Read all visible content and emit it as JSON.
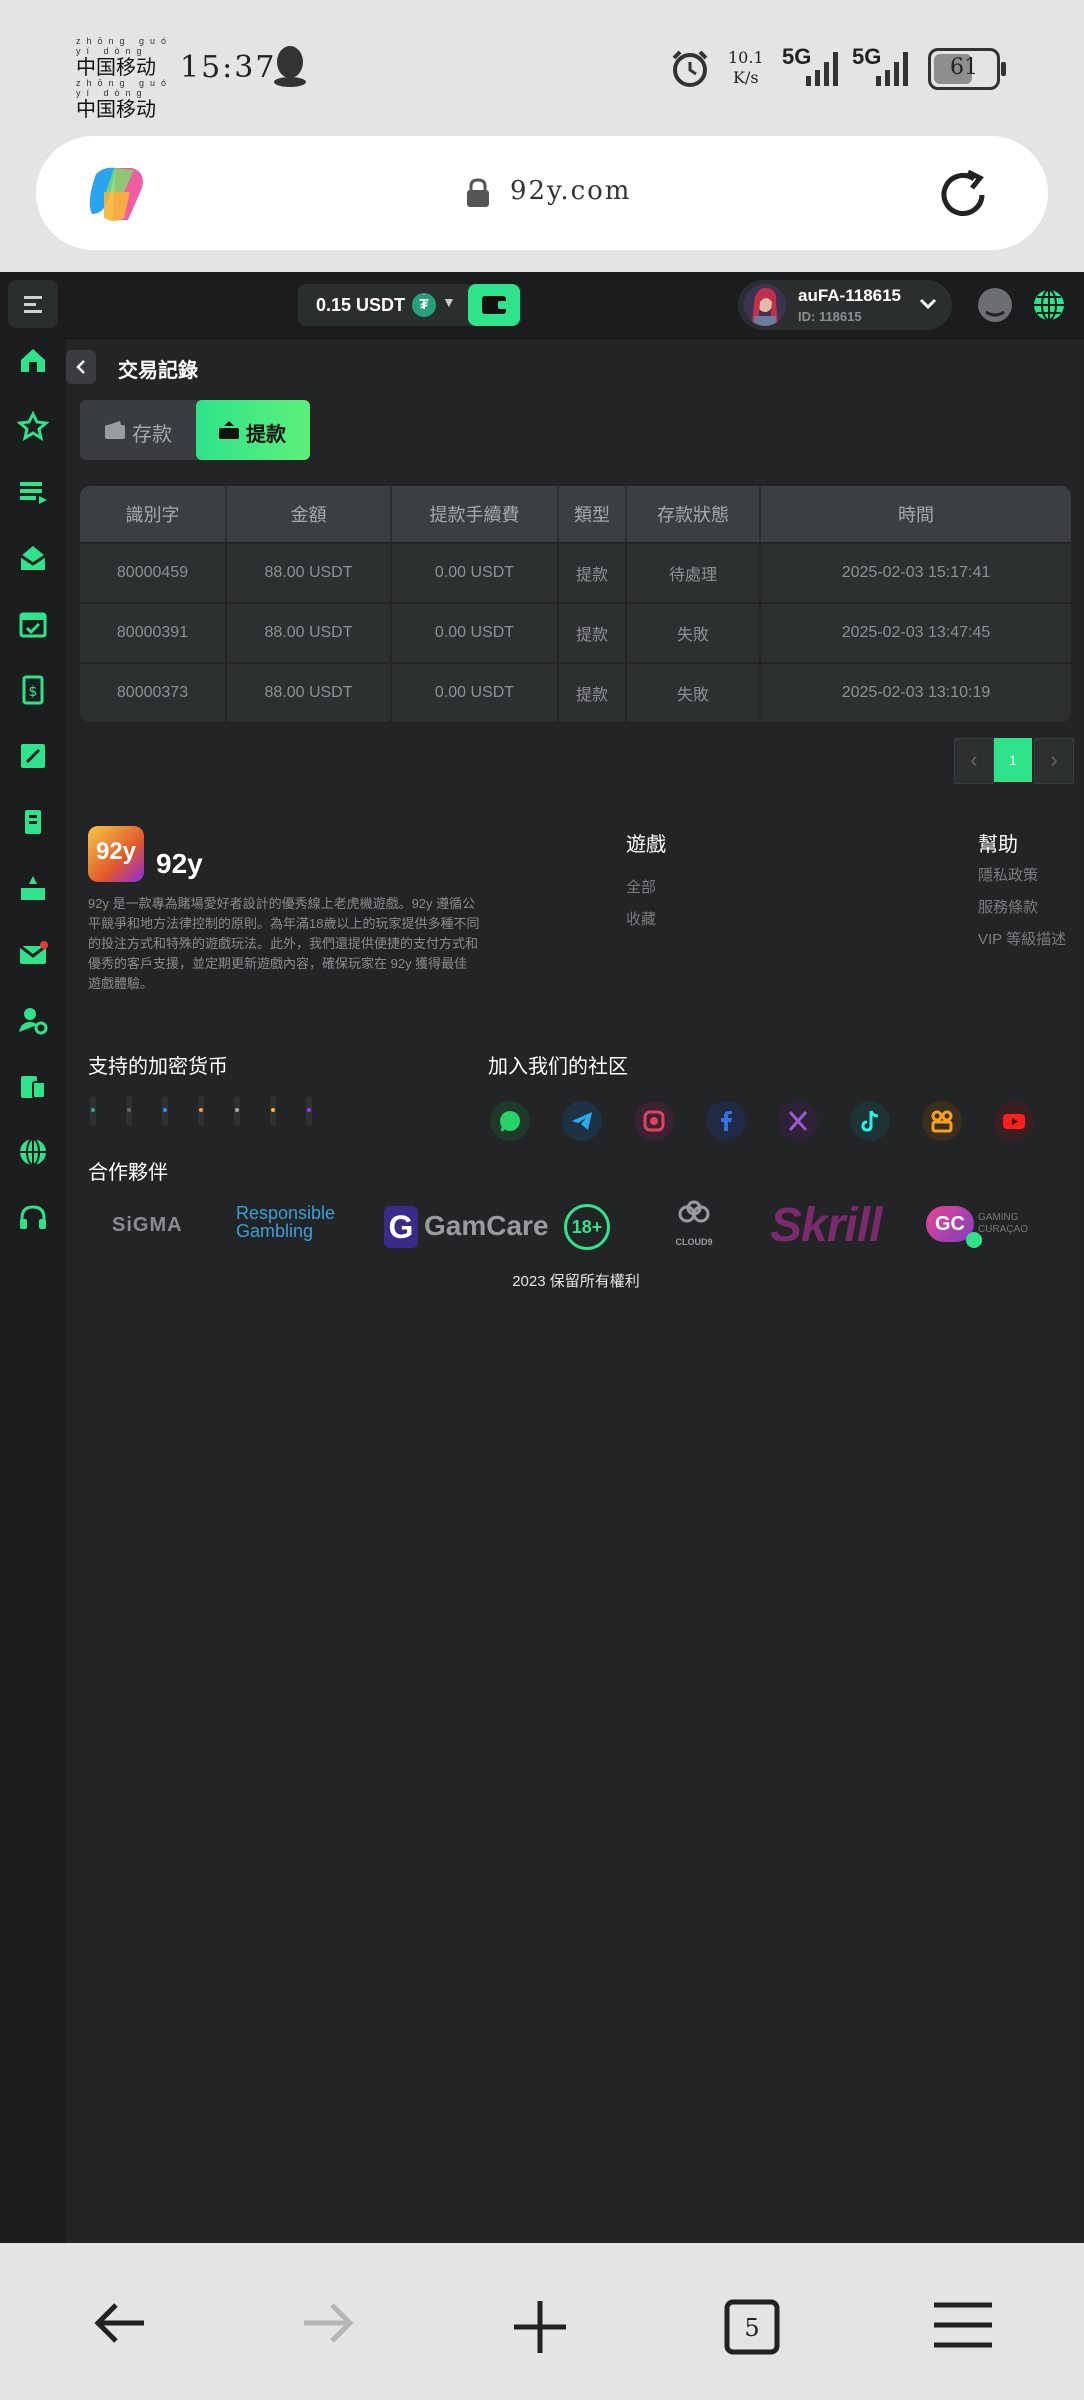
{
  "status": {
    "carrier_pinyin": "zhōng guó  yí dòng",
    "carrier1": "中国移动",
    "carrier2": "中国移动",
    "time": "15:37",
    "speed_value": "10.1",
    "speed_unit": "K/s",
    "net1": "5G",
    "net2": "5G",
    "battery": "61"
  },
  "browser": {
    "url": "92y.com"
  },
  "header": {
    "balance": "0.15 USDT",
    "username": "auFA-118615",
    "user_id": "ID: 118615"
  },
  "page": {
    "title": "交易記錄",
    "tabs": [
      {
        "label": "存款"
      },
      {
        "label": "提款"
      }
    ]
  },
  "table": {
    "headers": [
      "識別字",
      "金額",
      "提款手續費",
      "類型",
      "存款狀態",
      "時間"
    ],
    "rows": [
      [
        "80000459",
        "88.00 USDT",
        "0.00 USDT",
        "提款",
        "待處理",
        "2025-02-03 15:17:41"
      ],
      [
        "80000391",
        "88.00 USDT",
        "0.00 USDT",
        "提款",
        "失敗",
        "2025-02-03 13:47:45"
      ],
      [
        "80000373",
        "88.00 USDT",
        "0.00 USDT",
        "提款",
        "失敗",
        "2025-02-03 13:10:19"
      ]
    ]
  },
  "pagination": {
    "current": "1",
    "prev": "‹",
    "next": "›"
  },
  "footer": {
    "logo_badge": "92y",
    "brand": "92y",
    "description": "92y 是一款專為賭場愛好者設計的優秀線上老虎機遊戲。92y 遵循公平競爭和地方法律控制的原則。為年滿18歲以上的玩家提供多種不同的投注方式和特殊的遊戲玩法。此外，我們還提供便捷的支付方式和優秀的客戶支援，並定期更新遊戲內容，確保玩家在 92y 獲得最佳遊戲體驗。",
    "games": {
      "title": "遊戲",
      "links": [
        "全部",
        "收藏"
      ]
    },
    "help": {
      "title": "幫助",
      "links": [
        "隱私政策",
        "服務條款",
        "VIP 等級描述"
      ]
    },
    "crypto_title": "支持的加密货币",
    "community_title": "加入我们的社区",
    "partners_title": "合作夥伴",
    "partners": {
      "sigma": "SiGMA",
      "rg1": "Responsible",
      "rg2": "Gambling",
      "gamcare_g": "G",
      "gamcare": "GamCare",
      "age": "18+",
      "cloud9": "CLOUD9",
      "skrill": "Skrill",
      "gc": "GC",
      "curacao1": "GAMING",
      "curacao2": "CURAÇAO"
    },
    "copyright": "2023 保留所有權利"
  },
  "social_icons": [
    "whatsapp-icon",
    "telegram-icon",
    "instagram-icon",
    "facebook-icon",
    "x-icon",
    "tiktok-icon",
    "kuaishou-icon",
    "youtube-icon"
  ],
  "colors": {
    "accent": "#2fe38a",
    "page_bg": "#222425",
    "header_bg": "#1a1c1d"
  }
}
